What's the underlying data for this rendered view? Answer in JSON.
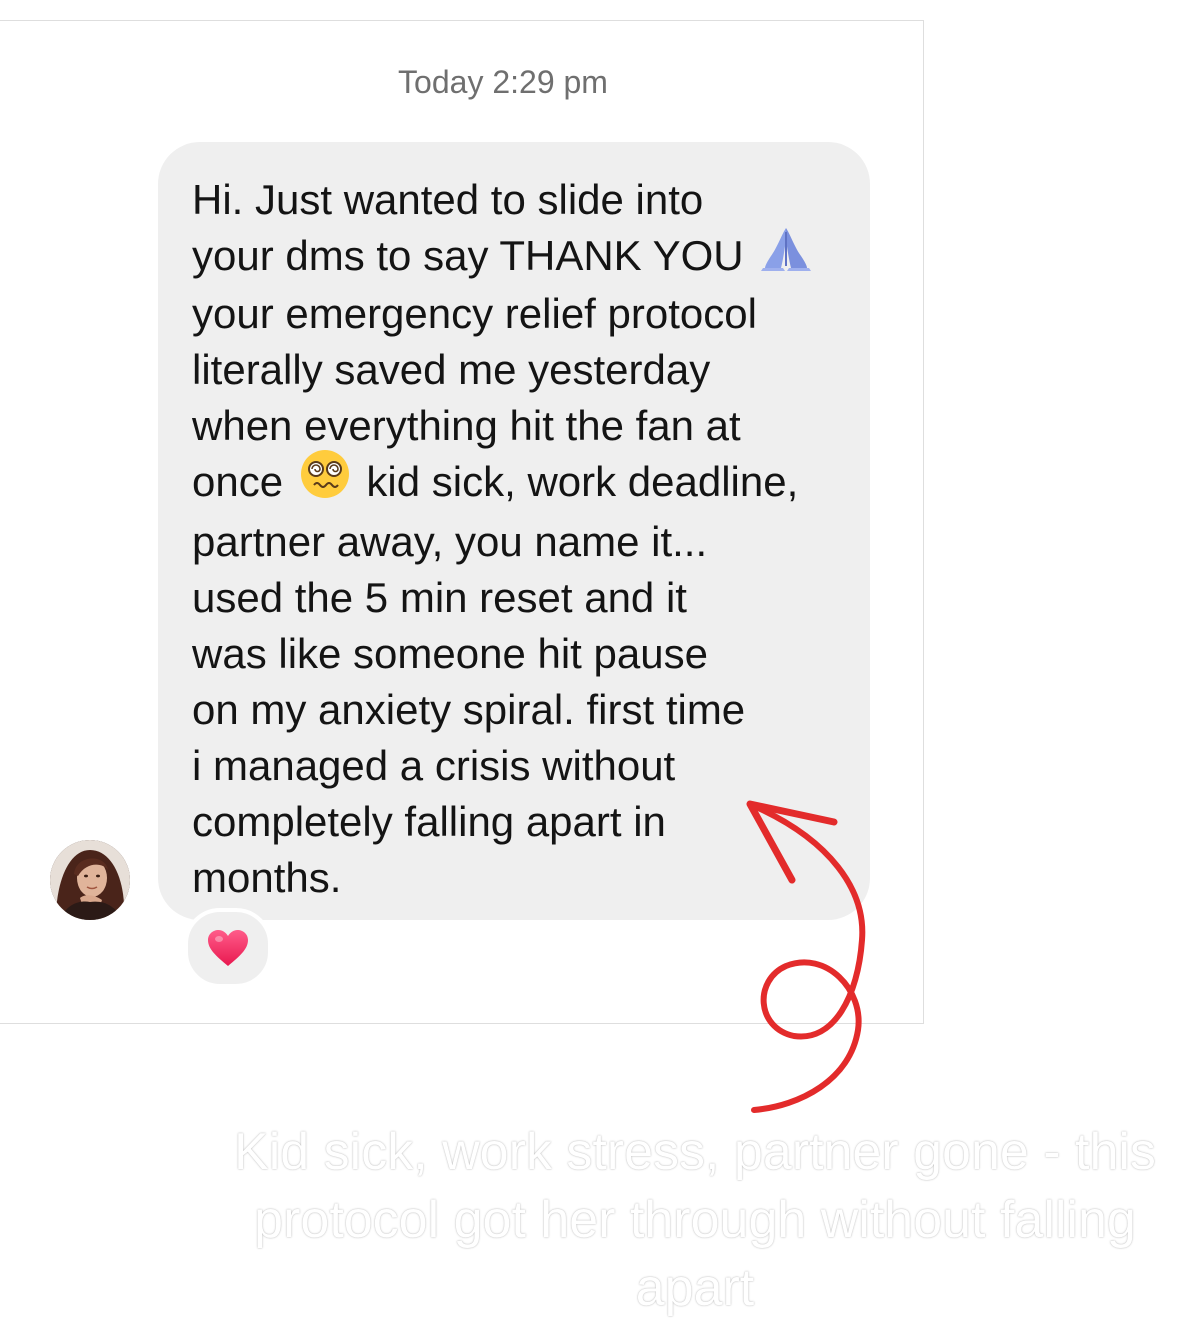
{
  "chat": {
    "timestamp": "Today 2:29 pm",
    "message_lines": [
      "Hi. Just wanted to slide into",
      "your dms to say THANK YOU",
      "your emergency relief protocol",
      "literally saved me yesterday",
      "when everything hit the fan at",
      "once",
      "kid sick, work deadline,",
      "partner away, you name it...",
      "used the 5 min reset and it",
      "was like someone hit pause",
      "on my anxiety spiral. first time",
      "i managed a crisis without",
      "completely falling apart in",
      "months."
    ],
    "emojis": {
      "line2": "folded-hands",
      "line6": "dizzy-face"
    },
    "reaction": "red-heart"
  },
  "annotation": {
    "arrow_color": "#e32b2b"
  },
  "caption": {
    "lines": [
      "Kid sick, work stress, partner gone - this",
      "protocol got her through without falling",
      "apart"
    ]
  }
}
